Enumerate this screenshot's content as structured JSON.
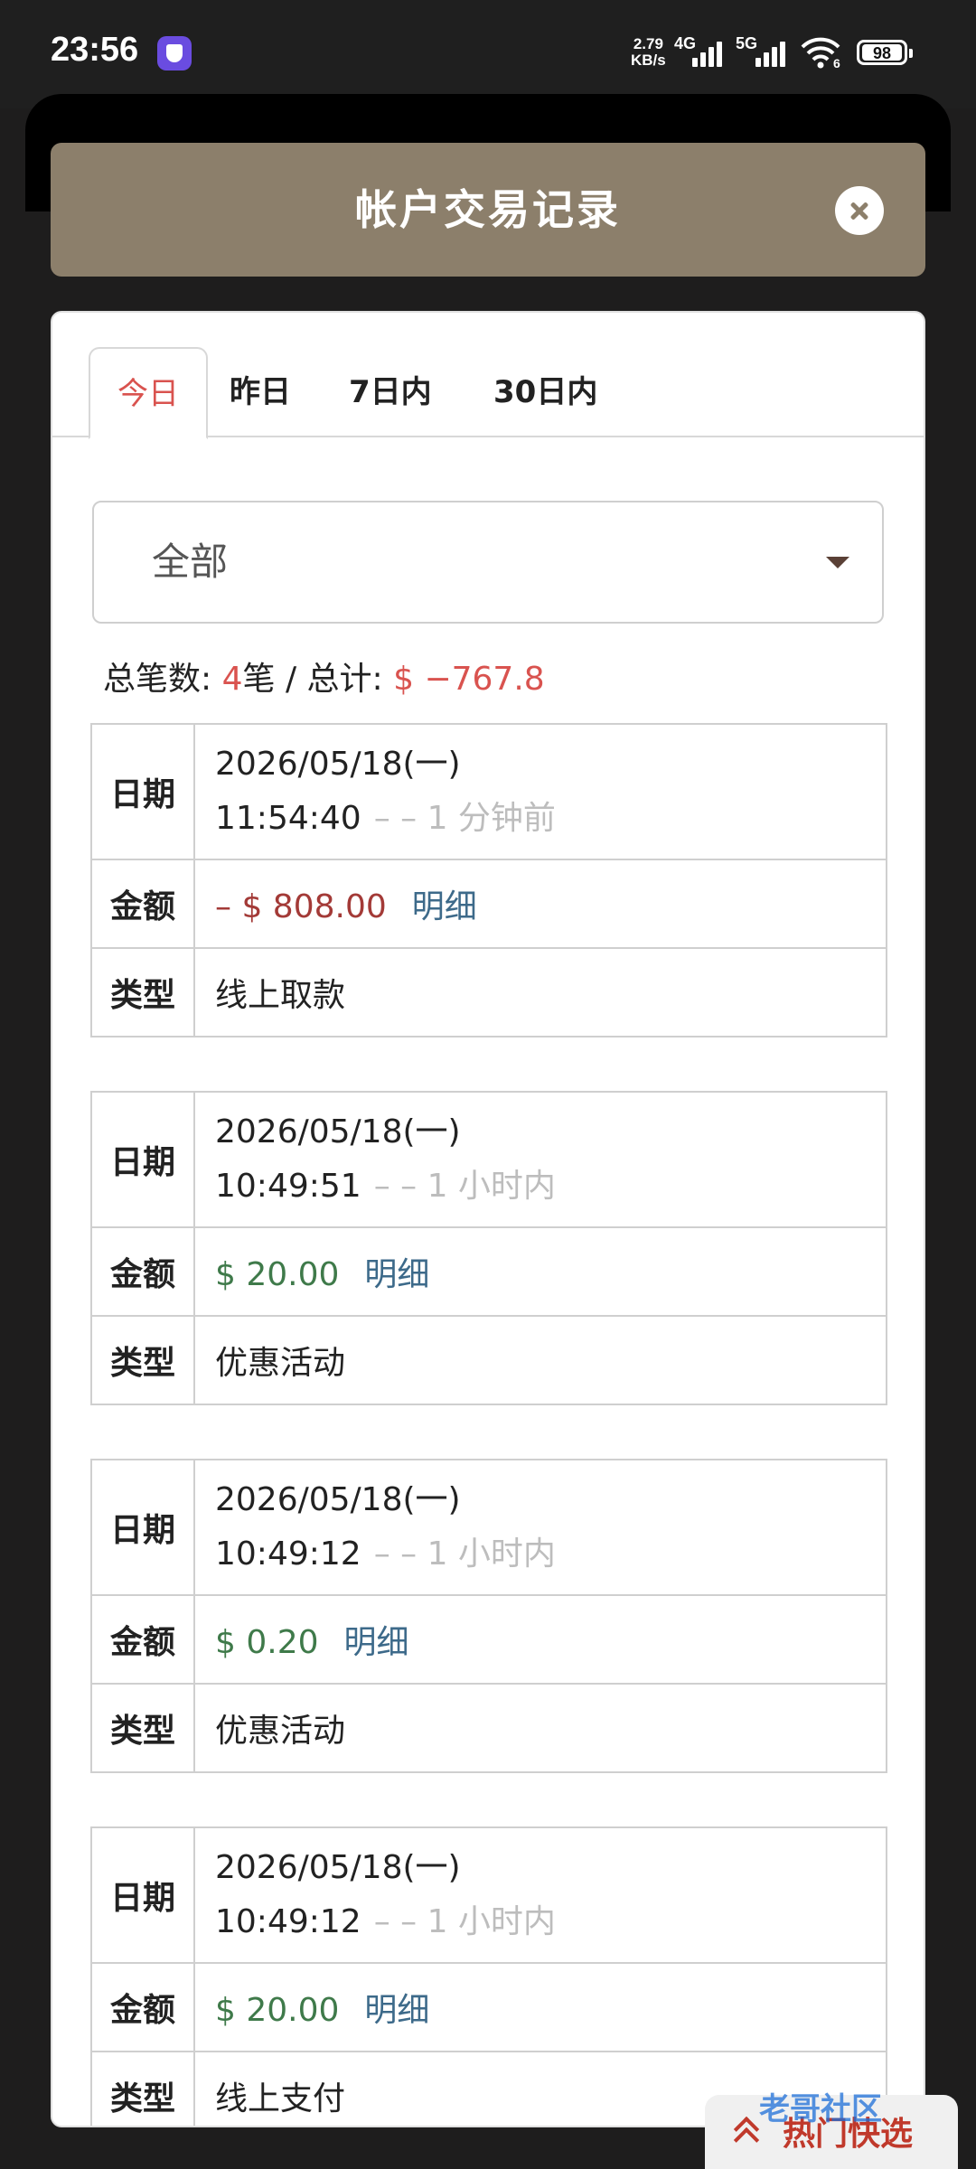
{
  "status_bar": {
    "time": "23:56",
    "speed_value": "2.79",
    "speed_unit": "KB/s",
    "net1": "4G",
    "net2": "5G",
    "wifi_badge": "6",
    "battery": "98"
  },
  "header": {
    "title": "帐户交易记录"
  },
  "tabs": [
    {
      "label": "今日",
      "active": true
    },
    {
      "label": "昨日",
      "active": false
    },
    {
      "label": "7日内",
      "active": false
    },
    {
      "label": "30日内",
      "active": false
    }
  ],
  "filter": {
    "value": "全部"
  },
  "summary": {
    "count_label": "总笔数: ",
    "count": "4",
    "count_unit": "笔",
    "sep": " / ",
    "total_label": "总计: ",
    "total": "$ −767.8"
  },
  "labels": {
    "date": "日期",
    "amount": "金额",
    "type": "类型",
    "detail": "明细"
  },
  "transactions": [
    {
      "date": "2026/05/18(一)",
      "time": "11:54:40",
      "ago": "–   – 1 分钟前",
      "amount": "– $ 808.00",
      "sign": "neg",
      "type": "线上取款"
    },
    {
      "date": "2026/05/18(一)",
      "time": "10:49:51",
      "ago": "–   – 1 小时内",
      "amount": "$ 20.00",
      "sign": "pos",
      "type": "优惠活动"
    },
    {
      "date": "2026/05/18(一)",
      "time": "10:49:12",
      "ago": "–   – 1 小时内",
      "amount": "$ 0.20",
      "sign": "pos",
      "type": "优惠活动"
    },
    {
      "date": "2026/05/18(一)",
      "time": "10:49:12",
      "ago": "–   – 1 小时内",
      "amount": "$ 20.00",
      "sign": "pos",
      "type": "线上支付"
    }
  ],
  "hot_picks": {
    "label": "热门快选"
  },
  "watermark": {
    "text": "老哥社区"
  },
  "colors": {
    "header": "#8c7f6b",
    "accent_red": "#d9534f",
    "positive": "#3f7a4a",
    "negative": "#a33a37",
    "link": "#3d6a8a"
  }
}
